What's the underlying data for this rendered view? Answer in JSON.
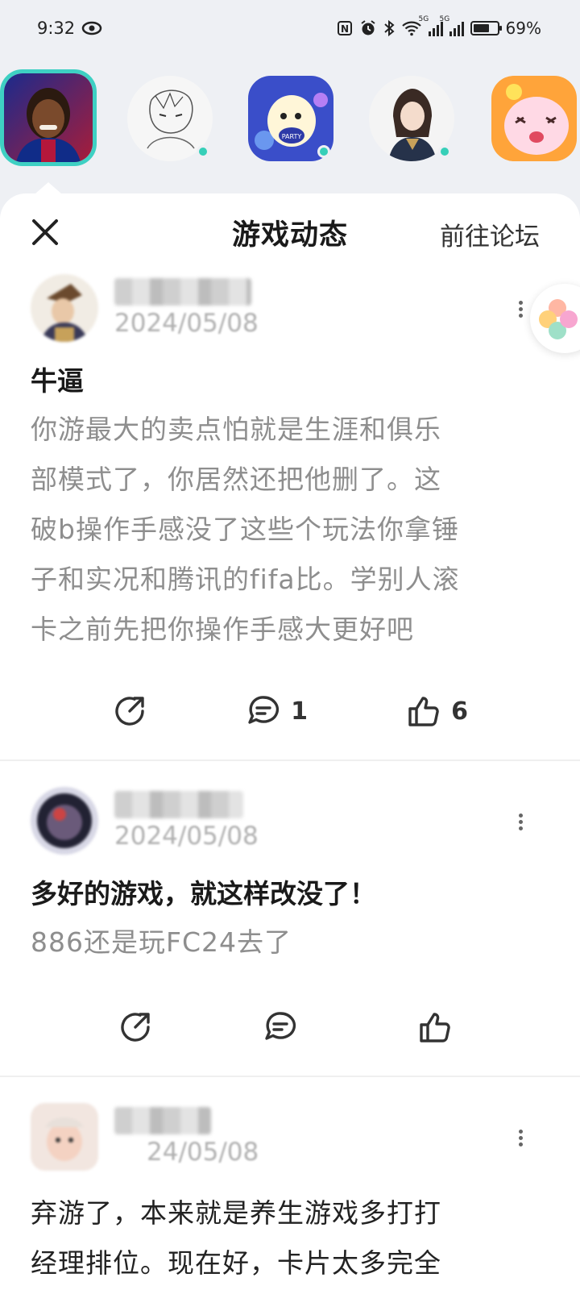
{
  "status_bar": {
    "time": "9:32",
    "battery": "69%",
    "battery_level": 0.69,
    "icons": [
      "eye-icon",
      "nfc-icon",
      "alarm-icon",
      "bluetooth-icon",
      "wifi-icon",
      "signal-5g-icon",
      "signal-5g-icon",
      "battery-icon"
    ]
  },
  "games": [
    {
      "name": "avatar-ronaldinho",
      "selected": true,
      "online": false
    },
    {
      "name": "avatar-sketch-character",
      "selected": false,
      "online": true
    },
    {
      "name": "avatar-eggy-party",
      "selected": false,
      "online": true
    },
    {
      "name": "avatar-anime-girl",
      "selected": false,
      "online": true
    },
    {
      "name": "avatar-cat-game",
      "selected": false,
      "online": false
    }
  ],
  "header": {
    "title": "游戏动态",
    "forum_link": "前往论坛"
  },
  "posts": [
    {
      "author_name": "",
      "date": "2024/05/08",
      "title": "牛逼",
      "body_lines": [
        "你游最大的卖点怕就是生涯和俱乐",
        "部模式了，你居然还把他删了。这",
        "破b操作手感没了这些个玩法你拿锤",
        "子和实况和腾讯的fifa比。学别人滚",
        "卡之前先把你操作手感大更好吧"
      ],
      "comments": "1",
      "likes": "6"
    },
    {
      "author_name": "",
      "date": "2024/05/08",
      "title": "多好的游戏，就这样改没了！",
      "body_lines": [
        "886还是玩FC24去了"
      ],
      "comments": "",
      "likes": ""
    },
    {
      "author_name": "",
      "date": "24/05/08",
      "title": "",
      "body_lines": [
        "弃游了，本来就是养生游戏多打打",
        "经理排位。现在好，卡片太多完全"
      ],
      "comments": "",
      "likes": ""
    }
  ]
}
